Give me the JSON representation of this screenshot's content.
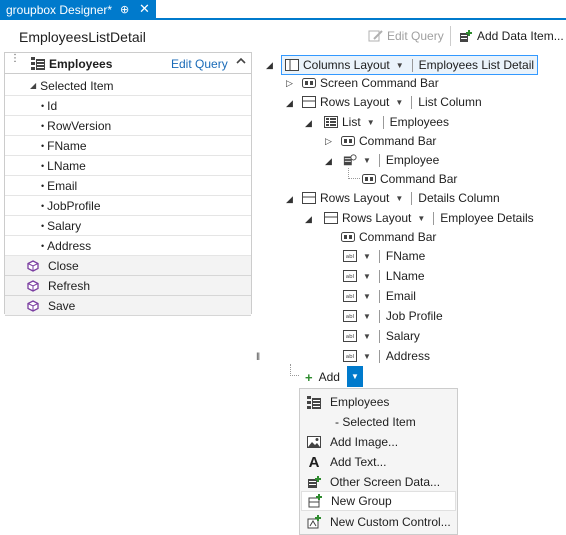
{
  "tab": {
    "title": "groupbox Designer*",
    "pin_glyph": "⊕",
    "close_glyph": "✕"
  },
  "header": {
    "screen_title": "EmployeesListDetail"
  },
  "toolbar": {
    "edit_query": "Edit Query",
    "add_data_item": "Add Data Item..."
  },
  "left_panel": {
    "title": "Employees",
    "edit_query": "Edit Query",
    "selected_item": "Selected Item",
    "fields": [
      "Id",
      "RowVersion",
      "FName",
      "LName",
      "Email",
      "JobProfile",
      "Salary",
      "Address"
    ],
    "commands": [
      "Close",
      "Refresh",
      "Save"
    ]
  },
  "tree": {
    "root": {
      "layout": "Columns Layout",
      "name": "Employees List Detail"
    },
    "screen_command_bar": "Screen Command Bar",
    "list_column": {
      "layout": "Rows Layout",
      "name": "List Column"
    },
    "list": {
      "control": "List",
      "name": "Employees"
    },
    "list_command_bar": "Command Bar",
    "employee": "Employee",
    "employee_command_bar": "Command Bar",
    "details_column": {
      "layout": "Rows Layout",
      "name": "Details Column"
    },
    "employee_details": {
      "layout": "Rows Layout",
      "name": "Employee Details"
    },
    "details_command_bar": "Command Bar",
    "fields": [
      "FName",
      "LName",
      "Email",
      "Job Profile",
      "Salary",
      "Address"
    ]
  },
  "add_button": {
    "label": "Add"
  },
  "add_menu": {
    "items": [
      "Employees",
      "- Selected Item",
      "Add Image...",
      "Add Text...",
      "Other Screen Data...",
      "New Group",
      "New Custom Control..."
    ],
    "highlighted": "New Group"
  },
  "colors": {
    "accent": "#007acc",
    "link": "#1a6bb8",
    "command_icon": "#7a3ea0"
  }
}
